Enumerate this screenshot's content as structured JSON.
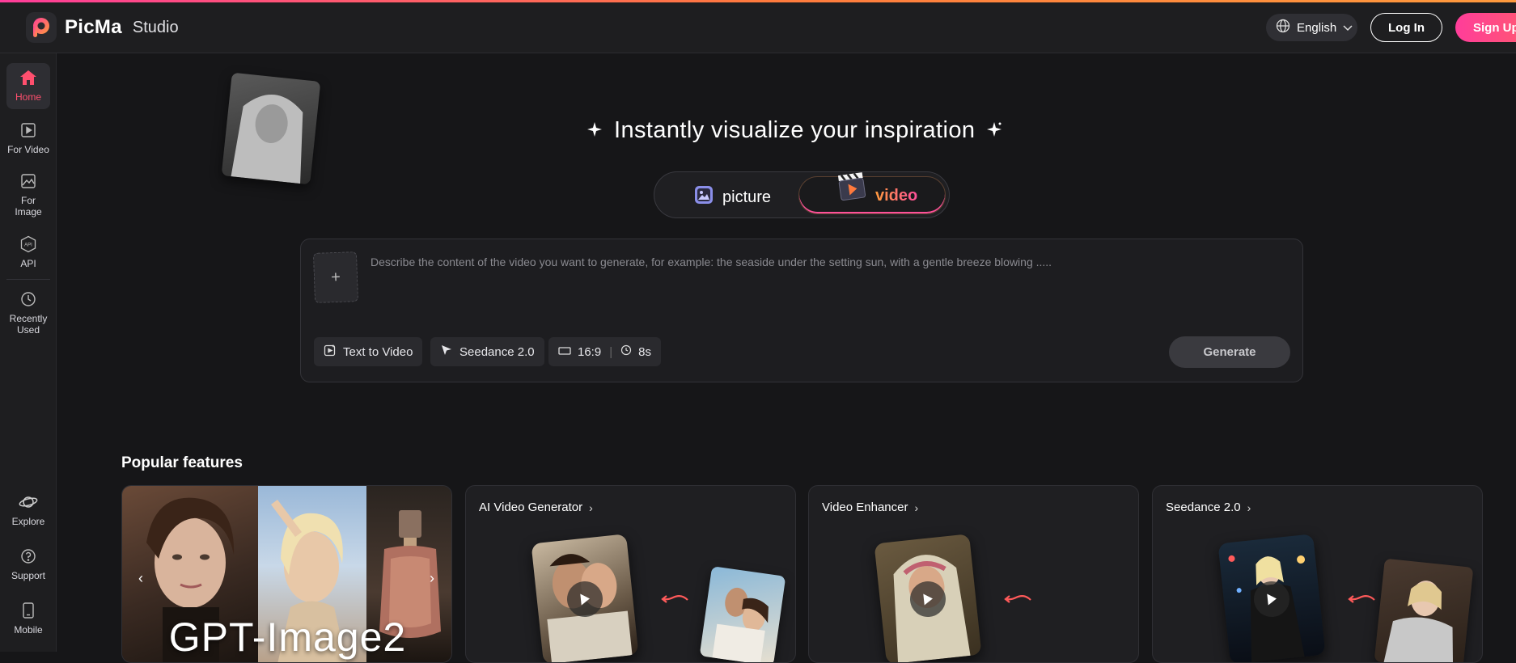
{
  "header": {
    "brand": "PicMa",
    "brand_sub": "Studio",
    "language": "English",
    "login": "Log In",
    "signup": "Sign Up"
  },
  "sidebar": {
    "items": [
      {
        "label": "Home",
        "icon": "home-icon"
      },
      {
        "label": "For Video",
        "icon": "play-square-icon"
      },
      {
        "label": "For Image",
        "icon": "image-icon"
      },
      {
        "label": "API",
        "icon": "api-hexagon-icon"
      },
      {
        "label": "Recently Used",
        "icon": "clock-icon"
      },
      {
        "label": "Explore",
        "icon": "planet-icon"
      },
      {
        "label": "Support",
        "icon": "help-circle-icon"
      },
      {
        "label": "Mobile",
        "icon": "mobile-icon"
      }
    ]
  },
  "hero": {
    "title": "Instantly visualize your inspiration"
  },
  "mode_toggle": {
    "picture": "picture",
    "video": "video",
    "selected": "video"
  },
  "prompt": {
    "placeholder": "Describe the content of the video you want to generate, for example: the seaside under the setting sun, with a gentle breeze blowing .....",
    "upload": "+",
    "mode_chip": "Text to Video",
    "model_chip": "Seedance 2.0",
    "ratio": "16:9",
    "duration": "8s",
    "generate": "Generate"
  },
  "features": {
    "title": "Popular features",
    "banner_text": "GPT-Image2",
    "cards": [
      {
        "title": "AI Video Generator"
      },
      {
        "title": "Video Enhancer"
      },
      {
        "title": "Seedance 2.0"
      }
    ]
  },
  "colors": {
    "accent_pink": "#ff3d9a",
    "accent_orange": "#ff9a3d",
    "background": "#161618",
    "panel": "#1e1e20"
  }
}
